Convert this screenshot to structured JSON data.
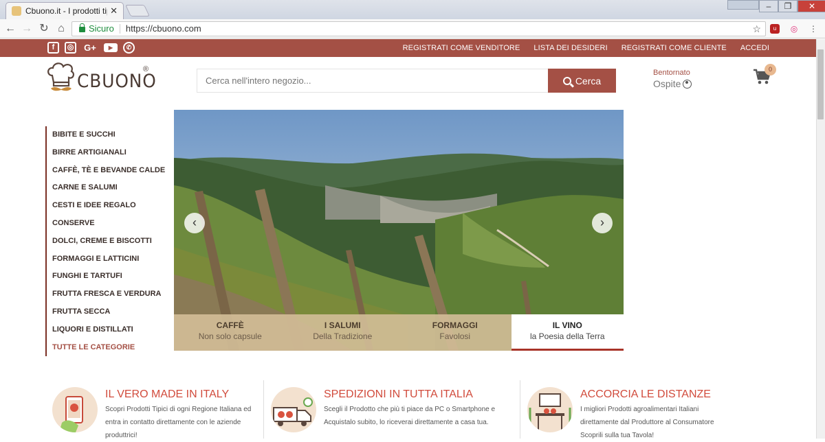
{
  "browser": {
    "tab_title": "Cbuono.it - I prodotti tipi",
    "tab_close": "✕",
    "secure_label": "Sicuro",
    "url": "https://cbuono.com"
  },
  "topbar": {
    "socials": [
      "facebook-icon",
      "instagram-icon",
      "google-plus-icon",
      "youtube-icon",
      "whatsapp-icon"
    ],
    "links": [
      "REGISTRATI COME VENDITORE",
      "LISTA DEI DESIDERI",
      "REGISTRATI COME CLIENTE",
      "ACCEDI"
    ]
  },
  "header": {
    "logo_text": "CBUONO",
    "logo_reg": "®",
    "search_placeholder": "Cerca nell'intero negozio...",
    "search_button": "Cerca",
    "welcome": "Bentornato",
    "user_name": "Ospite",
    "cart_count": "0"
  },
  "sidebar": {
    "categories": [
      "BIBITE E SUCCHI",
      "BIRRE ARTIGIANALI",
      "CAFFÈ, TÈ E BEVANDE CALDE",
      "CARNE E SALUMI",
      "CESTI E IDEE REGALO",
      "CONSERVE",
      "DOLCI, CREME E BISCOTTI",
      "FORMAGGI E LATTICINI",
      "FUNGHI E TARTUFI",
      "FRUTTA FRESCA E VERDURA",
      "FRUTTA SECCA",
      "LIQUORI E DISTILLATI"
    ],
    "all_label": "TUTTE LE CATEGORIE"
  },
  "slider": {
    "prev": "‹",
    "next": "›",
    "tabs": [
      {
        "title": "CAFFÈ",
        "subtitle": "Non solo capsule"
      },
      {
        "title": "I SALUMI",
        "subtitle": "Della Tradizione"
      },
      {
        "title": "FORMAGGI",
        "subtitle": "Favolosi"
      },
      {
        "title": "IL VINO",
        "subtitle": "la Poesia della Terra"
      }
    ],
    "active_index": 3
  },
  "features": [
    {
      "title": "IL VERO MADE IN ITALY",
      "text": "Scopri Prodotti Tipici di ogni Regione Italiana ed entra in contatto direttamente con le aziende produttrici!"
    },
    {
      "title": "SPEDIZIONI IN TUTTA ITALIA",
      "text": "Scegli il Prodotto che più ti piace da PC o Smartphone e Acquistalo subito, lo riceverai direttamente a casa tua."
    },
    {
      "title": "ACCORCIA LE DISTANZE",
      "text": "I migliori Prodotti agroalimentari Italiani direttamente dal Produttore al Consumatore Scoprili sulla tua Tavola!"
    }
  ],
  "colors": {
    "brand": "#a45045",
    "accent_title": "#d14b3c",
    "tab_active_border": "#a83328"
  }
}
